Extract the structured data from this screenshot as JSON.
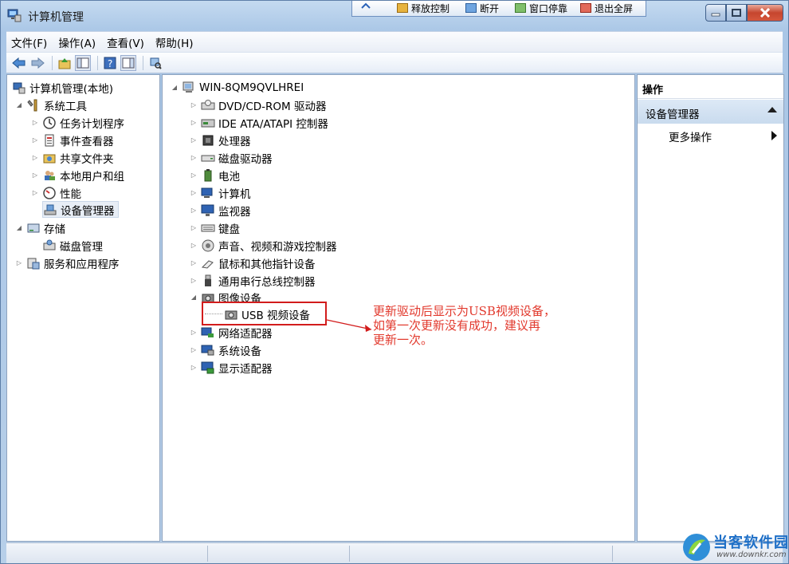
{
  "window": {
    "title": "计算机管理"
  },
  "remote_toolbar": {
    "items": [
      "释放控制",
      "断开",
      "窗口停靠",
      "退出全屏"
    ]
  },
  "menu": {
    "items": [
      "文件(F)",
      "操作(A)",
      "查看(V)",
      "帮助(H)"
    ]
  },
  "left_tree": {
    "root": "计算机管理(本地)",
    "system_tools": "系统工具",
    "task_scheduler": "任务计划程序",
    "event_viewer": "事件查看器",
    "shared_folders": "共享文件夹",
    "local_users": "本地用户和组",
    "performance": "性能",
    "device_manager": "设备管理器",
    "storage": "存储",
    "disk_management": "磁盘管理",
    "services_apps": "服务和应用程序"
  },
  "device_tree": {
    "computer_name": "WIN-8QM9QVLHREI",
    "categories": [
      "DVD/CD-ROM 驱动器",
      "IDE ATA/ATAPI 控制器",
      "处理器",
      "磁盘驱动器",
      "电池",
      "计算机",
      "监视器",
      "键盘",
      "声音、视频和游戏控制器",
      "鼠标和其他指针设备",
      "通用串行总线控制器",
      "图像设备",
      "USB 视频设备",
      "网络适配器",
      "系统设备",
      "显示适配器"
    ]
  },
  "actions_pane": {
    "header": "操作",
    "section": "设备管理器",
    "more": "更多操作"
  },
  "annotation": {
    "line1": "更新驱动后显示为USB视频设备，",
    "line2": "如第一次更新没有成功，建议再",
    "line3": "更新一次。",
    "color": "#e23a2e"
  },
  "watermark": {
    "title": "当客软件园",
    "url": "www.downkr.com"
  }
}
